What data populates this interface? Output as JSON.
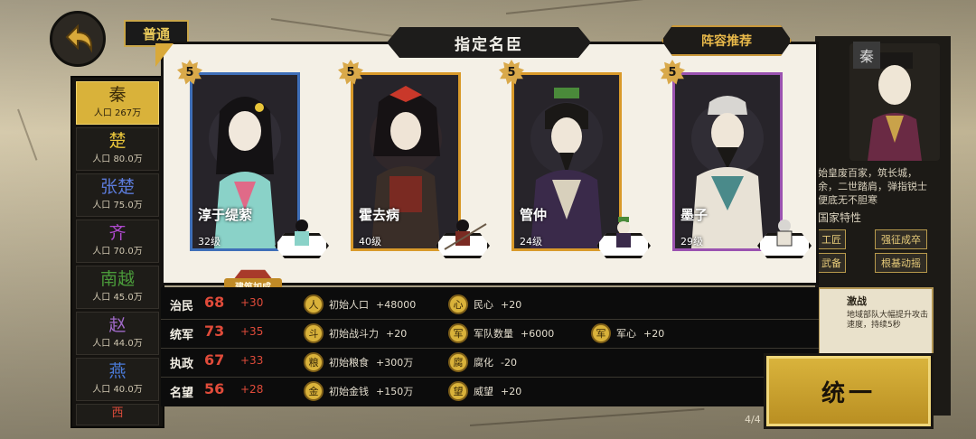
{
  "header": {
    "tab_label": "普通",
    "modal_title": "指定名臣",
    "recommend_label": "阵容推荐"
  },
  "sidebar": {
    "items": [
      {
        "name": "秦",
        "population": "人口 267万",
        "color": "#3a2a08",
        "active": true
      },
      {
        "name": "楚",
        "population": "人口 80.0万",
        "color": "#e9c53a",
        "active": false
      },
      {
        "name": "张楚",
        "population": "人口 75.0万",
        "color": "#5b7ad8",
        "active": false
      },
      {
        "name": "齐",
        "population": "人口 70.0万",
        "color": "#b04ad0",
        "active": false
      },
      {
        "name": "南越",
        "population": "人口 45.0万",
        "color": "#4a9a3a",
        "active": false
      },
      {
        "name": "赵",
        "population": "人口 44.0万",
        "color": "#a06ac8",
        "active": false
      },
      {
        "name": "燕",
        "population": "人口 40.0万",
        "color": "#4a7ad8",
        "active": false
      },
      {
        "name": "西",
        "population": "",
        "color": "#d84a3a",
        "active": false
      }
    ]
  },
  "cards": [
    {
      "name": "淳于缇萦",
      "level": "32级",
      "stars": "5",
      "border": "#3f6fb8"
    },
    {
      "name": "霍去病",
      "level": "40级",
      "stars": "5",
      "border": "#d99a2a"
    },
    {
      "name": "管仲",
      "level": "24级",
      "stars": "5",
      "border": "#d99a2a"
    },
    {
      "name": "墨子",
      "level": "29级",
      "stars": "5",
      "border": "#9a52b0"
    }
  ],
  "build_bonus_label": "建筑加成",
  "stats": [
    {
      "name": "治民",
      "value": "68",
      "bonus": "+30",
      "effects": [
        {
          "icon": "人",
          "label": "初始人口",
          "value": "+48000"
        },
        {
          "icon": "心",
          "label": "民心",
          "value": "+20"
        }
      ]
    },
    {
      "name": "统军",
      "value": "73",
      "bonus": "+35",
      "effects": [
        {
          "icon": "斗",
          "label": "初始战斗力",
          "value": "+20"
        },
        {
          "icon": "军",
          "label": "军队数量",
          "value": "+6000"
        },
        {
          "icon": "军",
          "label": "军心",
          "value": "+20"
        }
      ]
    },
    {
      "name": "执政",
      "value": "67",
      "bonus": "+33",
      "effects": [
        {
          "icon": "粮",
          "label": "初始粮食",
          "value": "+300万"
        },
        {
          "icon": "腐",
          "label": "腐化",
          "value": "-20"
        }
      ]
    },
    {
      "name": "名望",
      "value": "56",
      "bonus": "+28",
      "effects": [
        {
          "icon": "金",
          "label": "初始金钱",
          "value": "+150万"
        },
        {
          "icon": "望",
          "label": "威望",
          "value": "+20"
        }
      ]
    }
  ],
  "right_panel": {
    "nation_mark": "秦",
    "description": "始皇废百家，筑长城，余，二世踏肩，弹指锐士便底无不胆寒",
    "traits_title": "国家特性",
    "traits": [
      "工匠",
      "强征成卒",
      "武备",
      "根基动摇"
    ],
    "war_title": "激战",
    "war_desc": "地域部队大幅提升攻击速度，持续5秒",
    "page_indicator": "4/4"
  },
  "unify_label": "统一"
}
